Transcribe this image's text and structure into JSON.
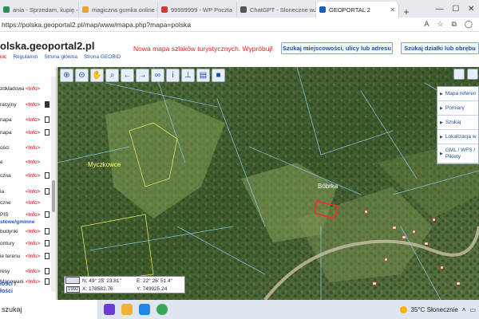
{
  "tabs": [
    {
      "label": "ania - Sprzedam, kupię -",
      "icon": "listing-icon",
      "color": "#2e8b57",
      "active": false
    },
    {
      "label": "magiczna gumka online - Szuk",
      "icon": "search-icon",
      "color": "#e9a23b",
      "active": false
    },
    {
      "label": "99999999 - WP Poczta",
      "icon": "mail-icon",
      "color": "#d2373a",
      "active": false
    },
    {
      "label": "ChatGPT - Słoneczne wzgórz",
      "icon": "chatgpt-icon",
      "color": "#555555",
      "active": false
    },
    {
      "label": "GEOPORTAL 2",
      "icon": "geoportal-icon",
      "color": "#1a5fb4",
      "active": true
    }
  ],
  "newtab": "+",
  "window": {
    "minimize": "—",
    "maximize": "☐",
    "close": "✕"
  },
  "address": {
    "url": "https://polska.geoportal2.pl/map/www/mapa.php?mapa=polska"
  },
  "header": {
    "logo": "olska.geoportal2.pl",
    "promo": "Nowa mapa szlaków turystycznych. Wypróbuj!",
    "subnav_red": "ioc",
    "subnav": [
      "Regulamin",
      "Strona główna",
      "Strona GEOBID"
    ],
    "search_address": "Szukaj miejscowości, ulicy lub adresu",
    "search_plot": "Szukaj działki lub obrębu"
  },
  "layers": [
    {
      "label": "zdkładowa",
      "info": "<Info>",
      "doc": false
    },
    {
      "label": "racyjny",
      "info": "<Info>",
      "doc": true
    },
    {
      "label": "napa",
      "info": "<Info>",
      "doc": true
    },
    {
      "label": "napa",
      "info": "<Info>",
      "doc": true
    },
    {
      "label": "ości",
      "info": "<Info>",
      "doc": false
    },
    {
      "label": "e",
      "info": "<Info>",
      "doc": false
    },
    {
      "label": "czna",
      "info": "<Info>",
      "doc": true
    },
    {
      "label": "ia",
      "info": "<Info>",
      "doc": true
    },
    {
      "label": "czne",
      "info": "<Info>",
      "doc": false
    },
    {
      "label": "PIS",
      "info": "<Info>",
      "doc": true
    },
    {
      "label": "budynki",
      "info": "<Info>",
      "doc": true
    },
    {
      "label": "ontury",
      "info": "<Info>",
      "doc": true
    },
    {
      "label": "ie terenu",
      "info": "<Info>",
      "doc": true
    },
    {
      "label": "resy",
      "info": "<Info>",
      "doc": true
    },
    {
      "label": "Mapowanie",
      "info": "<Info>",
      "doc": true
    }
  ],
  "section_heading": "stowe/gminne",
  "bottom_links": [
    "Mapowanie",
    "łości i",
    "łości"
  ],
  "right_panel": [
    "Mapa referen",
    "Pomiary",
    "Szukaj",
    "Lokalizacja w",
    "GML / WFS / Pikiety"
  ],
  "map": {
    "label1": "Myczkowce",
    "label2": "Bóbrka"
  },
  "coords": {
    "n": "N: 49° 25' 23.81\"",
    "e": "E: 22° 26' 51.4\"",
    "x": "X: 178582.76",
    "y": "Y: 749925.24",
    "system": "1992"
  },
  "taskbar": {
    "search": "szukaj",
    "weather": "35°C  Słonecznie"
  }
}
